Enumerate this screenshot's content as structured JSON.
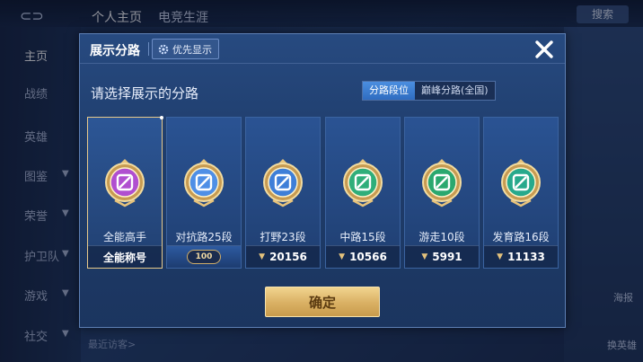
{
  "background": {
    "tabs": [
      "个人主页",
      "电竞生涯"
    ],
    "sidebar": [
      {
        "label": "主页",
        "chevron": false
      },
      {
        "label": "战绩",
        "chevron": false
      },
      {
        "label": "英雄",
        "chevron": false
      },
      {
        "label": "图鉴",
        "chevron": true
      },
      {
        "label": "荣誉",
        "chevron": true
      },
      {
        "label": "护卫队",
        "chevron": true
      },
      {
        "label": "游戏",
        "chevron": true
      },
      {
        "label": "社交",
        "chevron": true
      }
    ],
    "search_label": "搜索",
    "right_labels": [
      "海报",
      "换英雄"
    ],
    "recent_visitors": "最近访客>"
  },
  "dialog": {
    "title": "展示分路",
    "priority_label": "优先显示",
    "prompt": "请选择展示的分路",
    "tabs": [
      {
        "label": "分路段位",
        "active": true
      },
      {
        "label": "巅峰分路(全国)",
        "active": false
      }
    ],
    "cards": [
      {
        "name": "全能高手",
        "footer": "全能称号",
        "footer_type": "title",
        "selected": true,
        "badge_color": "#b04fd0"
      },
      {
        "name": "对抗路25段",
        "footer": "100",
        "footer_type": "rank",
        "selected": false,
        "badge_color": "#4f8fe6"
      },
      {
        "name": "打野23段",
        "footer": "20156",
        "footer_type": "score",
        "selected": false,
        "badge_color": "#3f7fd8"
      },
      {
        "name": "中路15段",
        "footer": "10566",
        "footer_type": "score",
        "selected": false,
        "badge_color": "#2fae7a"
      },
      {
        "name": "游走10段",
        "footer": "5991",
        "footer_type": "score",
        "selected": false,
        "badge_color": "#2aa86f"
      },
      {
        "name": "发育路16段",
        "footer": "11133",
        "footer_type": "score",
        "selected": false,
        "badge_color": "#27a98c"
      }
    ],
    "confirm_label": "确定"
  }
}
